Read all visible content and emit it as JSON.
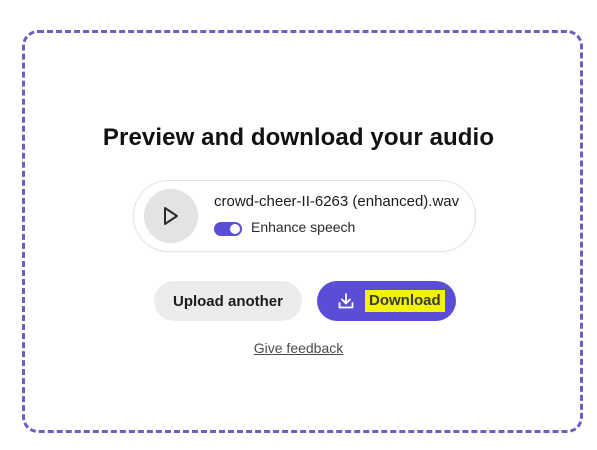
{
  "dialog": {
    "title": "Preview and download your audio"
  },
  "player": {
    "play_icon": "play-icon",
    "filename": "crowd-cheer-II-6263 (enhanced).wav",
    "enhance_toggle": {
      "label": "Enhance speech",
      "on": true
    }
  },
  "actions": {
    "upload_label": "Upload another",
    "download_label": "Download",
    "download_icon": "download-icon"
  },
  "feedback_link": "Give feedback",
  "colors": {
    "accent": "#5a4ed6",
    "border": "#6a5fc4",
    "highlight": "#f2f20a",
    "neutral_button": "#ececec"
  }
}
